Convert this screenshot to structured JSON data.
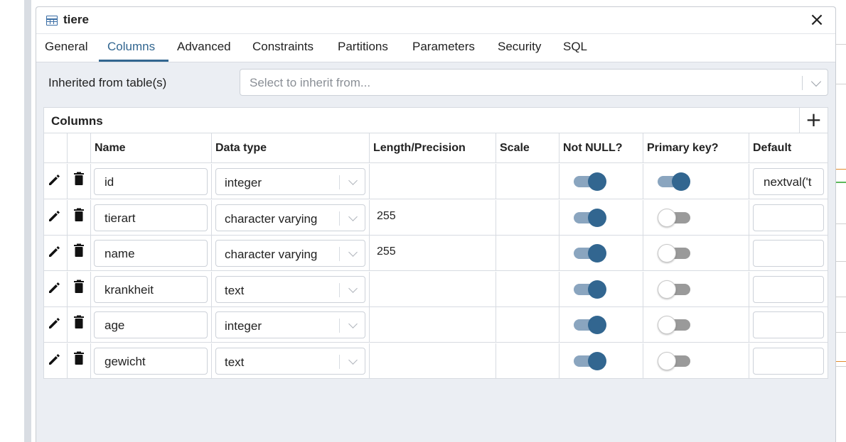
{
  "dialog": {
    "title": "tiere",
    "close_label": "×"
  },
  "tabs": [
    {
      "label": "General"
    },
    {
      "label": "Columns",
      "active": true
    },
    {
      "label": "Advanced"
    },
    {
      "label": "Constraints"
    },
    {
      "label": "Partitions"
    },
    {
      "label": "Parameters"
    },
    {
      "label": "Security"
    },
    {
      "label": "SQL"
    }
  ],
  "inherit": {
    "label": "Inherited from table(s)",
    "placeholder": "Select to inherit from..."
  },
  "columns_grid": {
    "title": "Columns",
    "add_label": "+",
    "headers": {
      "name": "Name",
      "data_type": "Data type",
      "length": "Length/Precision",
      "scale": "Scale",
      "not_null": "Not NULL?",
      "primary_key": "Primary key?",
      "default": "Default"
    },
    "rows": [
      {
        "name": "id",
        "data_type": "integer",
        "length": "",
        "scale": "",
        "not_null": true,
        "primary_key": true,
        "default": "nextval('t"
      },
      {
        "name": "tierart",
        "data_type": "character varying",
        "length": "255",
        "scale": "",
        "not_null": true,
        "primary_key": false,
        "default": ""
      },
      {
        "name": "name",
        "data_type": "character varying",
        "length": "255",
        "scale": "",
        "not_null": true,
        "primary_key": false,
        "default": ""
      },
      {
        "name": "krankheit",
        "data_type": "text",
        "length": "",
        "scale": "",
        "not_null": true,
        "primary_key": false,
        "default": ""
      },
      {
        "name": "age",
        "data_type": "integer",
        "length": "",
        "scale": "",
        "not_null": true,
        "primary_key": false,
        "default": ""
      },
      {
        "name": "gewicht",
        "data_type": "text",
        "length": "",
        "scale": "",
        "not_null": true,
        "primary_key": false,
        "default": ""
      }
    ]
  },
  "colors": {
    "accent": "#326690",
    "toggle_on_track": "#8aa5bf",
    "toggle_off_track": "#9a9a9a",
    "dialog_bg": "#ebeef3"
  },
  "icons": {
    "title": "table-icon",
    "close": "close-icon",
    "add": "plus-icon",
    "edit": "pencil-icon",
    "delete": "trash-icon",
    "dropdown": "chevron-down-icon"
  }
}
